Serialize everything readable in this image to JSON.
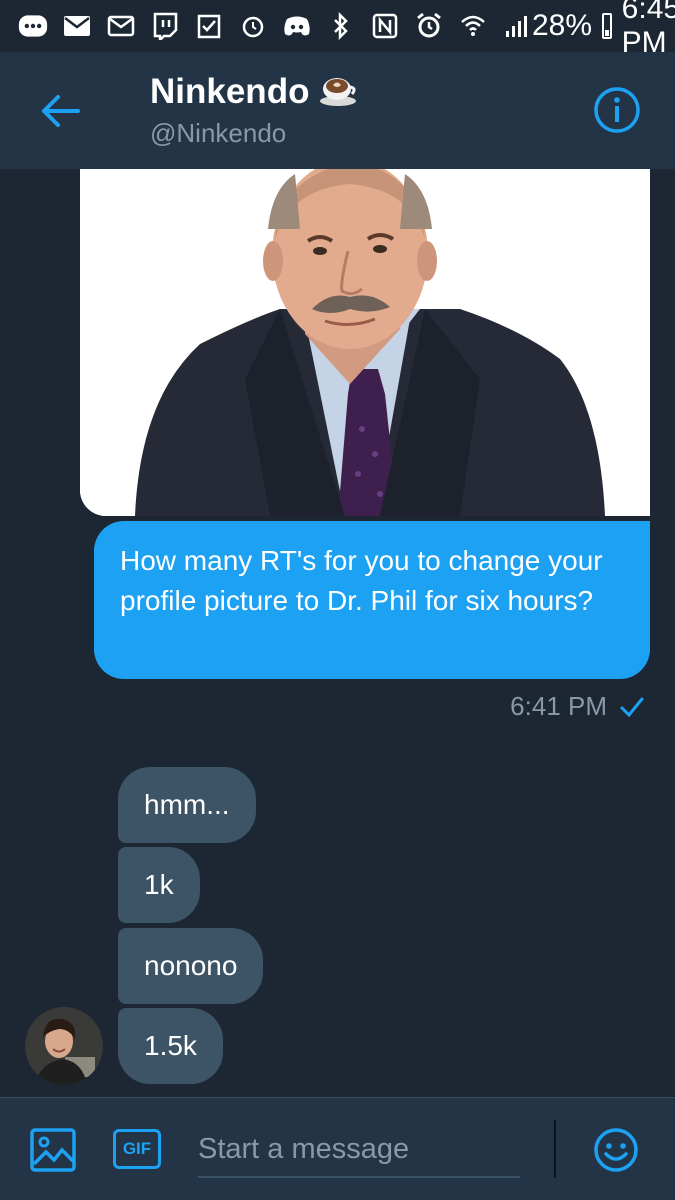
{
  "status_bar": {
    "icons": [
      "more-icon",
      "mail-icon",
      "mail-outline-icon",
      "twitch-icon",
      "checkbox-icon",
      "alarm-icon",
      "discord-icon",
      "bluetooth-icon",
      "nfc-icon",
      "alarm-clock-icon",
      "wifi-icon",
      "signal-icon"
    ],
    "battery": "28%",
    "time": "6:45 PM"
  },
  "header": {
    "name": "Ninkendo",
    "emoji": "☕",
    "handle": "@Ninkendo"
  },
  "conversation": {
    "sent_message": "How many RT's for you to change your profile picture to Dr. Phil for six hours?",
    "sent_time": "6:41 PM",
    "received": [
      "hmm...",
      "1k",
      "nonono",
      "1.5k"
    ]
  },
  "composer": {
    "gif_label": "GIF",
    "placeholder": "Start a message"
  },
  "colors": {
    "accent": "#1da1f2",
    "background": "#1c2733",
    "header": "#243447",
    "bubble_in": "#3d5466"
  }
}
